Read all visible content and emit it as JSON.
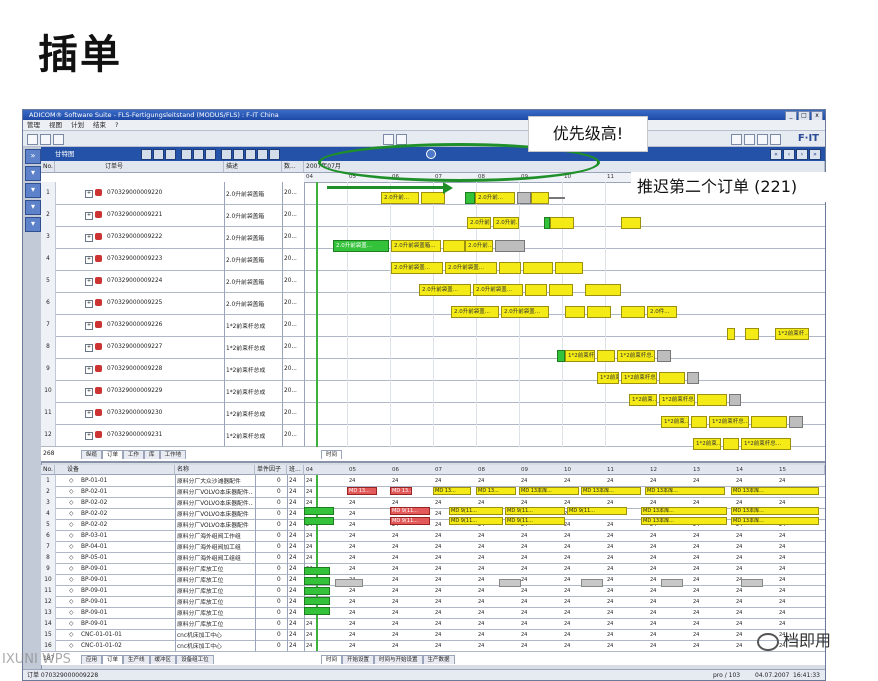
{
  "slide_title": "插单",
  "app": {
    "title": "ADICOM® Software Suite - FLS-Fertigungsleitstand (MODUS/FLS) : F-IT China",
    "menu": [
      "管理",
      "视图",
      "计划",
      "结束",
      "?"
    ],
    "logo": "F·IT",
    "gantt_title": "甘特图",
    "upper_headers": {
      "no": "No.",
      "order": "订单号",
      "desc": "描述",
      "col4": "数..."
    },
    "date_header": "2007年07月",
    "dates": [
      "04",
      "05",
      "06",
      "07",
      "08",
      "09",
      "10",
      "11"
    ],
    "orders": [
      {
        "no": "1",
        "id": "070329000009220",
        "desc": "2.0升前袋盖箱",
        "val": "20..."
      },
      {
        "no": "2",
        "id": "070329000009221",
        "desc": "2.0升前袋盖箱",
        "val": "20..."
      },
      {
        "no": "3",
        "id": "070329000009222",
        "desc": "2.0升前袋盖箱",
        "val": "20..."
      },
      {
        "no": "4",
        "id": "070329000009223",
        "desc": "2.0升前袋盖箱",
        "val": "20..."
      },
      {
        "no": "5",
        "id": "070329000009224",
        "desc": "2.0升前袋盖箱",
        "val": "20..."
      },
      {
        "no": "6",
        "id": "070329000009225",
        "desc": "2.0升前袋盖箱",
        "val": "20..."
      },
      {
        "no": "7",
        "id": "070329000009226",
        "desc": "1*2前束杆总成",
        "val": "20..."
      },
      {
        "no": "8",
        "id": "070329000009227",
        "desc": "1*2前束杆总成",
        "val": "20..."
      },
      {
        "no": "9",
        "id": "070329000009228",
        "desc": "1*2前束杆总成",
        "val": "20..."
      },
      {
        "no": "10",
        "id": "070329000009229",
        "desc": "1*2前束杆总成",
        "val": "20..."
      },
      {
        "no": "11",
        "id": "070329000009230",
        "desc": "1*2前束杆总成",
        "val": "20..."
      },
      {
        "no": "12",
        "id": "070329000009231",
        "desc": "1*2前束杆总成",
        "val": "20..."
      }
    ],
    "upper_count": "268",
    "bar_labels": {
      "a": "2.0升前...",
      "b": "2.0升前袋盖...",
      "c": "2.0升前袋盖箱...",
      "d": "2.0升前袋盖...",
      "e": "1*2前束杆...",
      "f": "1*2前束杆总...",
      "g": "1*2前束...",
      "h": "2.0件..."
    },
    "upper_tabs": [
      "纵缆",
      "订单",
      "工作",
      "库",
      "工作地"
    ],
    "upper_right_tabs": [
      "时间"
    ],
    "lower_headers": {
      "no": "No.",
      "equip": "设备",
      "name": "名称",
      "x1": "单件因子",
      "x2": "班..."
    },
    "dates2": [
      "04",
      "05",
      "06",
      "07",
      "08",
      "09",
      "10",
      "11",
      "12",
      "13",
      "14",
      "15"
    ],
    "equipment": [
      {
        "no": "1",
        "code": "BP-01-01",
        "name": "原料分厂大众沙滩器配件",
        "a": "0",
        "b": "24"
      },
      {
        "no": "2",
        "code": "BP-02-01",
        "name": "原料分厂VOLVO本床器配件...",
        "a": "0",
        "b": "24"
      },
      {
        "no": "3",
        "code": "BP-02-02",
        "name": "原料分厂VOLVO本床器配件...",
        "a": "0",
        "b": "24"
      },
      {
        "no": "4",
        "code": "BP-02-02",
        "name": "原料分厂VOLVO本床器配件",
        "a": "0",
        "b": "24"
      },
      {
        "no": "5",
        "code": "BP-02-02",
        "name": "原料分厂VOLVO本床器配件",
        "a": "0",
        "b": "24"
      },
      {
        "no": "6",
        "code": "BP-03-01",
        "name": "原料分厂海外组阀工作组",
        "a": "0",
        "b": "24"
      },
      {
        "no": "7",
        "code": "BP-04-01",
        "name": "原料分厂海外组阀加工组",
        "a": "0",
        "b": "24"
      },
      {
        "no": "8",
        "code": "BP-05-01",
        "name": "原料分厂海外组阀工组组",
        "a": "0",
        "b": "24"
      },
      {
        "no": "9",
        "code": "BP-09-01",
        "name": "原料分厂库放工位",
        "a": "0",
        "b": "24"
      },
      {
        "no": "10",
        "code": "BP-09-01",
        "name": "原料分厂库放工位",
        "a": "0",
        "b": "24"
      },
      {
        "no": "11",
        "code": "BP-09-01",
        "name": "原料分厂库放工位",
        "a": "0",
        "b": "24"
      },
      {
        "no": "12",
        "code": "BP-09-01",
        "name": "原料分厂库放工位",
        "a": "0",
        "b": "24"
      },
      {
        "no": "13",
        "code": "BP-09-01",
        "name": "原料分厂库放工位",
        "a": "0",
        "b": "24"
      },
      {
        "no": "14",
        "code": "BP-09-01",
        "name": "原料分厂库放工位",
        "a": "0",
        "b": "24"
      },
      {
        "no": "15",
        "code": "CNC-01-01-01",
        "name": "cnc机床加工中心",
        "a": "0",
        "b": "24"
      },
      {
        "no": "16",
        "code": "CNC-01-01-02",
        "name": "cnc机床加工中心",
        "a": "0",
        "b": "24"
      }
    ],
    "lower_count": "187",
    "lower_tabs": [
      "应用",
      "订单",
      "生产线",
      "缓冲区",
      "设备组工位"
    ],
    "lower_right_tabs": [
      "时间",
      "开始设置",
      "时间与开始设置",
      "生产数据"
    ],
    "lower_cell": "24",
    "lower_bar_labels": {
      "md": "MD 13...",
      "md2": "MD 9(11...",
      "mdr": "MD 13本库...",
      "g": "24"
    },
    "status_left": "订单 070329000009228",
    "status_mid": "pro / 103",
    "status_right": "04.07.2007",
    "status_time": "16:41:33"
  },
  "callout_priority": "优先级高!",
  "callout_postpone": "推迟第二个订单 (221)",
  "watermark_brand": "档即用",
  "watermark_left": "IXUNI  WPS"
}
